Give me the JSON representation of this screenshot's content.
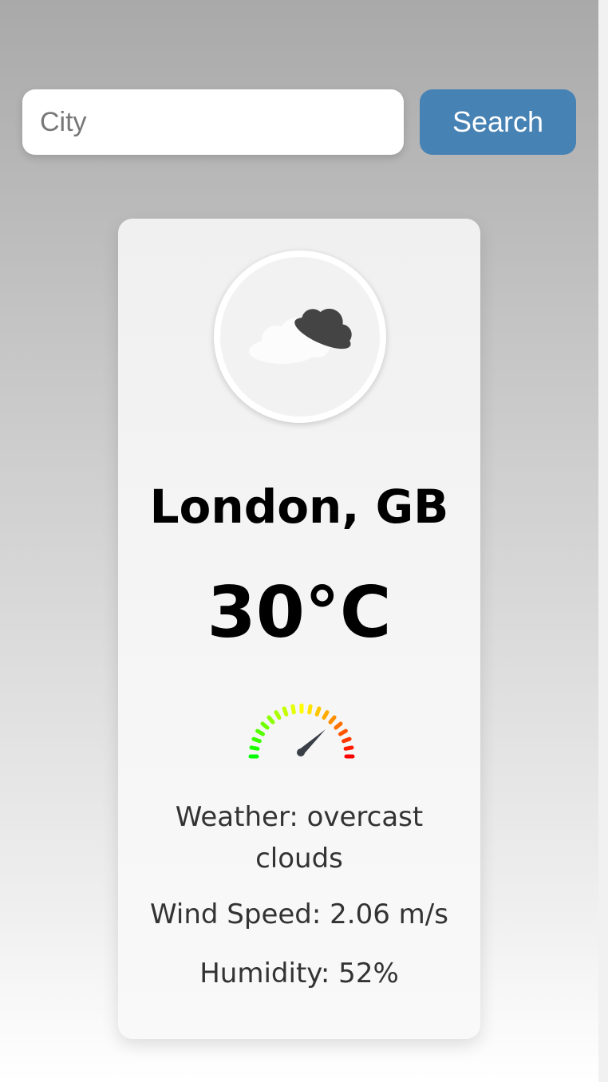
{
  "search": {
    "placeholder": "City",
    "value": "",
    "button_label": "Search"
  },
  "weather": {
    "icon": "overcast-clouds-icon",
    "location": "London, GB",
    "temperature": "30°C",
    "description": "Weather: overcast clouds",
    "wind_speed": "Wind Speed: 2.06 m/s",
    "humidity": "Humidity: 52%",
    "gauge_icon": "speedometer-icon"
  },
  "colors": {
    "accent": "#4682b4",
    "card_background": "#f4f4f4",
    "text_primary": "#000000",
    "text_secondary": "#333333"
  }
}
